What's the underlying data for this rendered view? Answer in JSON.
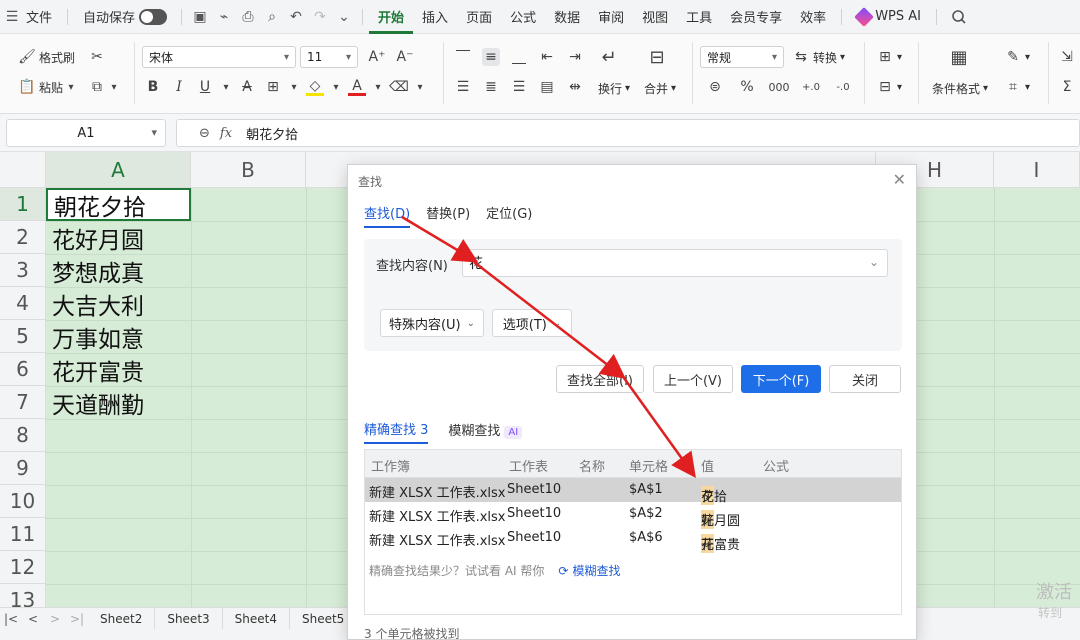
{
  "menubar": {
    "file": "文件",
    "autosave": "自动保存",
    "tabs": [
      "开始",
      "插入",
      "页面",
      "公式",
      "数据",
      "审阅",
      "视图",
      "工具",
      "会员专享",
      "效率"
    ],
    "ai": "WPS AI"
  },
  "ribbon": {
    "format_painter": "格式刷",
    "paste": "粘贴",
    "font_name": "宋体",
    "font_size": "11",
    "number_format": "常规",
    "convert": "转换",
    "wrap": "换行",
    "merge": "合并",
    "cond_format": "条件格式"
  },
  "formula_bar": {
    "name_box": "A1",
    "formula": "朝花夕拾"
  },
  "grid": {
    "columns": [
      "A",
      "B",
      "H",
      "I"
    ],
    "rows": [
      "1",
      "2",
      "3",
      "4",
      "5",
      "6",
      "7",
      "8",
      "9",
      "10",
      "11",
      "12",
      "13"
    ],
    "cells": [
      "朝花夕拾",
      "花好月圆",
      "梦想成真",
      "大吉大利",
      "万事如意",
      "花开富贵",
      "天道酬勤"
    ]
  },
  "sheets": [
    "Sheet2",
    "Sheet3",
    "Sheet4",
    "Sheet5"
  ],
  "dialog": {
    "title": "查找",
    "tabs": [
      "查找(D)",
      "替换(P)",
      "定位(G)"
    ],
    "find_label": "查找内容(N)",
    "find_value": "花",
    "special_btn": "特殊内容(U)",
    "options_btn": "选项(T)",
    "buttons": {
      "find_all": "查找全部(I)",
      "prev": "上一个(V)",
      "next": "下一个(F)",
      "close": "关闭"
    },
    "result_tabs": {
      "exact": "精确查找 3",
      "fuzzy": "模糊查找",
      "ai": "AI"
    },
    "headers": [
      "工作簿",
      "工作表",
      "名称",
      "单元格",
      "值",
      "公式"
    ],
    "rows": [
      {
        "book": "新建 XLSX 工作表.xlsx",
        "sheet": "Sheet10",
        "cell": "$A$1",
        "v_pre": "朝",
        "v_hl": "花",
        "v_post": "夕拾"
      },
      {
        "book": "新建 XLSX 工作表.xlsx",
        "sheet": "Sheet10",
        "cell": "$A$2",
        "v_pre": "",
        "v_hl": "花",
        "v_post": "好月圆"
      },
      {
        "book": "新建 XLSX 工作表.xlsx",
        "sheet": "Sheet10",
        "cell": "$A$6",
        "v_pre": "",
        "v_hl": "花",
        "v_post": "开富贵"
      }
    ],
    "hint": "精确查找结果少？试试看 AI 帮你",
    "hint_link": "模糊查找",
    "footer": "3 个单元格被找到"
  },
  "watermark": {
    "line1": "激活",
    "line2": "转到"
  },
  "colors": {
    "accent_green": "#1f7a3a",
    "accent_blue": "#1e6ee8",
    "grid_bg": "#d7ecd7",
    "arrow_red": "#e02020"
  }
}
